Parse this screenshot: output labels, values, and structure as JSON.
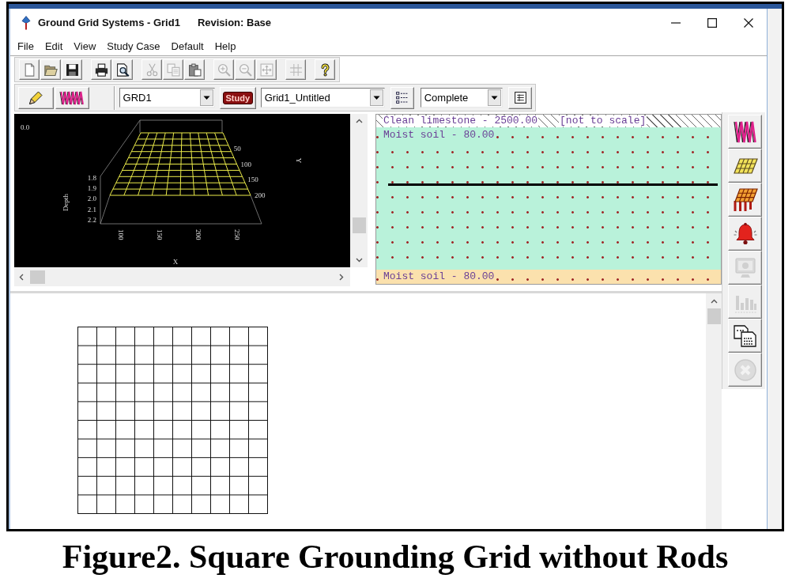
{
  "window": {
    "title": "Ground Grid Systems - Grid1",
    "revision": "Revision: Base"
  },
  "menu": [
    "File",
    "Edit",
    "View",
    "Study Case",
    "Default",
    "Help"
  ],
  "toolbar": [
    {
      "disabled": false
    },
    {
      "disabled": false
    },
    {
      "disabled": false
    },
    {
      "disabled": false
    },
    {
      "disabled": false
    },
    {
      "disabled": true
    },
    {
      "disabled": true
    },
    {
      "disabled": false
    },
    {
      "disabled": true
    },
    {
      "disabled": true
    },
    {
      "disabled": true
    },
    {
      "disabled": true
    },
    {
      "disabled": false
    }
  ],
  "toolbar_2": {
    "dropdown_1": "GRD1",
    "study_button": "Study",
    "dropdown_2": "Grid1_Untitled",
    "dropdown_3": "Complete"
  },
  "plot_3d": {
    "top_value": "0.0",
    "depth_label": "Depth",
    "depth_ticks": [
      "1.8",
      "1.9",
      "2.0",
      "2.1",
      "2.2"
    ],
    "x_label": "X",
    "x_ticks": [
      "100",
      "150",
      "200",
      "250"
    ],
    "y_label": "Y",
    "y_ticks": [
      "50",
      "100",
      "150",
      "200"
    ]
  },
  "soil_profile": {
    "layers": [
      {
        "kind": "hatched",
        "label": "Clean limestone - 2500.00",
        "note": "[not to scale]",
        "color": "#ffffff",
        "grid_line": false
      },
      {
        "kind": "dotted",
        "label": "Moist soil - 80.00",
        "color": "#b9f2da",
        "grid_line": true
      },
      {
        "kind": "dotted",
        "label": "Moist soil - 80.00",
        "color": "#fbe1ad",
        "grid_line": false
      }
    ]
  },
  "right_toolbar": [
    {
      "disabled": false
    },
    {
      "disabled": false
    },
    {
      "disabled": false
    },
    {
      "disabled": false
    },
    {
      "disabled": true
    },
    {
      "disabled": true
    },
    {
      "disabled": false
    },
    {
      "disabled": true
    }
  ],
  "caption": "Figure2. Square Grounding Grid without Rods"
}
